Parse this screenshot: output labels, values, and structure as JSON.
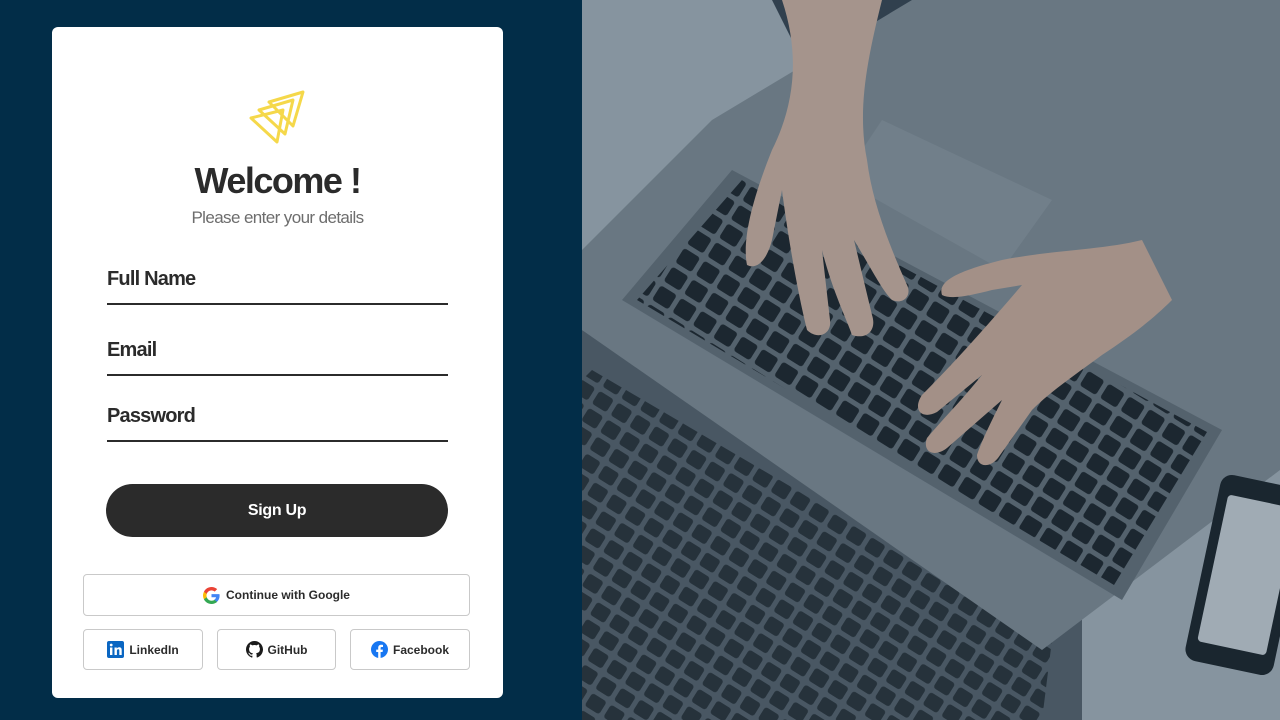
{
  "brand": {
    "logo_icon": "triangle-stack-logo-icon",
    "accent": "#f5d84a",
    "background": "#022d48",
    "text_dark": "#2b2b2b"
  },
  "header": {
    "title": "Welcome !",
    "subtitle": "Please enter your details"
  },
  "form": {
    "full_name_label": "Full Name",
    "email_label": "Email",
    "password_label": "Password",
    "submit_label": "Sign Up"
  },
  "social": {
    "google_label": "Continue with Google",
    "linkedin_label": "LinkedIn",
    "github_label": "GitHub",
    "facebook_label": "Facebook"
  },
  "hero": {
    "image": "hands-typing-on-laptop-photo"
  }
}
